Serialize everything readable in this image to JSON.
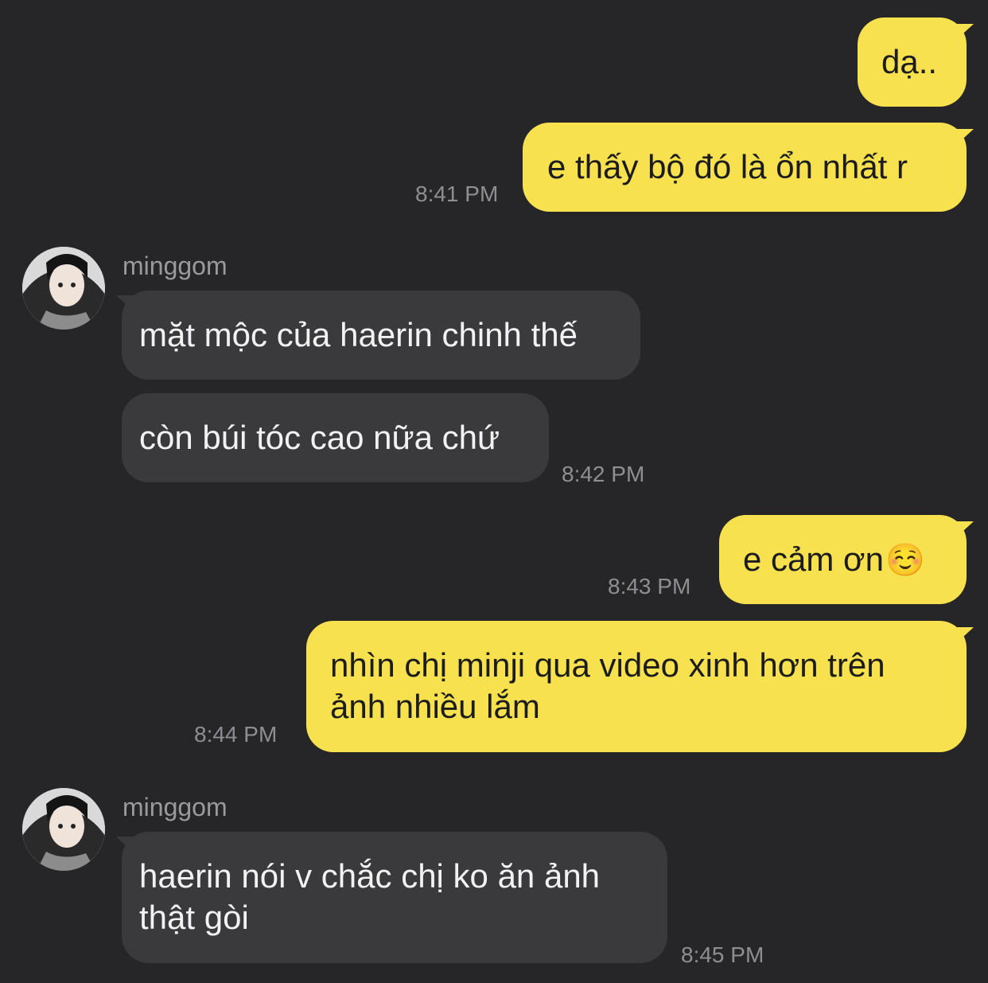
{
  "colors": {
    "background": "#262628",
    "my_bubble": "#f7e14f",
    "their_bubble": "#3a3a3c",
    "timestamp": "#8e8e93"
  },
  "messages": [
    {
      "from": "me",
      "text": "dạ.."
    },
    {
      "from": "me",
      "text": "e thấy bộ đó là ổn nhất r",
      "time": "8:41 PM"
    },
    {
      "from": "them",
      "sender": "minggom",
      "avatar": "profile-photo",
      "text": "mặt mộc của haerin chinh thế"
    },
    {
      "from": "them",
      "text": "còn búi tóc cao nữa chứ",
      "time": "8:42 PM"
    },
    {
      "from": "me",
      "text": "e cảm ơn",
      "emoji": "☺️",
      "time": "8:43 PM"
    },
    {
      "from": "me",
      "text_line1": "nhìn chị minji qua video xinh hơn trên",
      "text_line2": "ảnh nhiều lắm",
      "time": "8:44 PM"
    },
    {
      "from": "them",
      "sender": "minggom",
      "avatar": "profile-photo",
      "text_line1": "haerin nói v chắc chị ko ăn ảnh",
      "text_line2": "thật gòi",
      "time": "8:45 PM"
    }
  ]
}
